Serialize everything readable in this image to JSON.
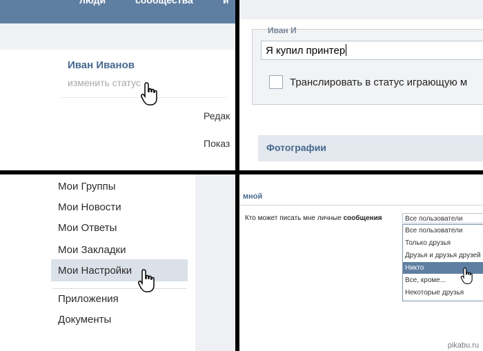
{
  "panel1": {
    "topbar": {
      "item_a": "люди",
      "item_b": "сообщества"
    },
    "profile_name": "Иван Иванов",
    "status_link": "изменить статус",
    "side_edit": "Редак",
    "side_show": "Показ"
  },
  "panel2": {
    "status_value": "Я купил принтер",
    "broadcast_label": "Транслировать в статус играющую м",
    "photos_title": "Фотографии"
  },
  "panel3": {
    "menu": [
      "Мои Группы",
      "Мои Новости",
      "Мои Ответы",
      "Мои Закладки",
      "Мои Настройки"
    ],
    "menu2": [
      "Приложения",
      "Документы"
    ],
    "selected_index": 4
  },
  "panel4": {
    "header": "мной",
    "question_text": "Кто может писать мне личные ",
    "question_bold": "сообщения",
    "select_value": "Все пользователи",
    "options": [
      "Все пользователи",
      "Только друзья",
      "Друзья и друзья друзей",
      "Никто",
      "Все, кроме...",
      "Некоторые друзья"
    ],
    "selected_option_index": 3
  },
  "watermark": "pikabu.ru",
  "colors": {
    "vk_blue": "#5f7fa2",
    "link_blue": "#45688e"
  }
}
